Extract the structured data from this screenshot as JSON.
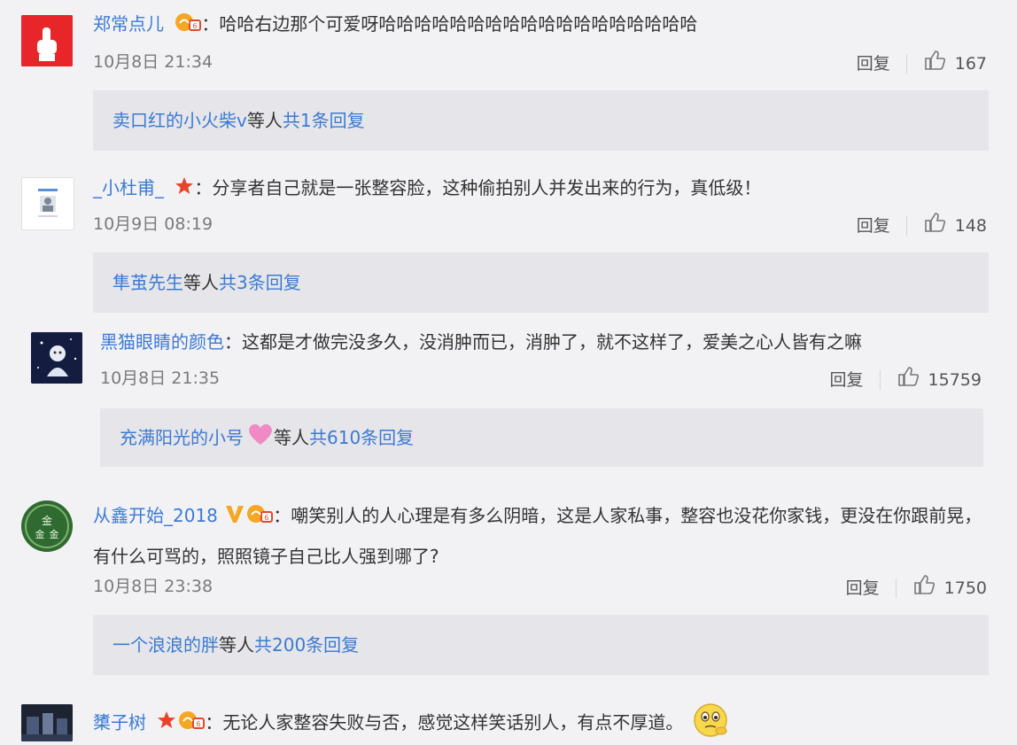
{
  "comments": [
    {
      "user": "郑常点儿",
      "sep": "：",
      "text": "哈哈右边那个可爱呀哈哈哈哈哈哈哈哈哈哈哈哈哈哈哈哈哈哈",
      "time": "10月8日 21:34",
      "reply_label": "回复",
      "likes": "167",
      "reply_thread": {
        "name": "卖口红的小火柴v",
        "mid": " 等人 ",
        "count": "共1条回复"
      }
    },
    {
      "user": "_小杜甫_",
      "sep": "：",
      "text": "分享者自己就是一张整容脸，这种偷拍别人并发出来的行为，真低级！",
      "time": "10月9日 08:19",
      "reply_label": "回复",
      "likes": "148",
      "reply_thread": {
        "name": "隼茧先生",
        "mid": " 等人 ",
        "count": "共3条回复"
      }
    },
    {
      "user": "黑猫眼睛的颜色",
      "sep": "：",
      "text": "这都是才做完没多久，没消肿而已，消肿了，就不这样了，爱美之心人皆有之嘛",
      "time": "10月8日 21:35",
      "reply_label": "回复",
      "likes": "15759",
      "reply_thread": {
        "name": "充满阳光的小号",
        "mid": " 等人 ",
        "count": "共610条回复"
      }
    },
    {
      "user": "从鑫开始_2018",
      "sep": "：",
      "text": "嘲笑别人的人心理是有多么阴暗，这是人家私事，整容也没花你家钱，更没在你跟前晃，有什么可骂的，照照镜子自己比人强到哪了?",
      "time": "10月8日 23:38",
      "reply_label": "回复",
      "likes": "1750",
      "reply_thread": {
        "name": "一个浪浪的胖",
        "mid": " 等人 ",
        "count": "共200条回复"
      }
    },
    {
      "user": "橥子树",
      "sep": "：",
      "text": "无论人家整容失败与否，感觉这样笑话别人，有点不厚道。"
    }
  ],
  "colors": {
    "link": "#3b7ad3",
    "reply_bg": "#e6e6ea",
    "page_bg": "#f2f2f5"
  }
}
